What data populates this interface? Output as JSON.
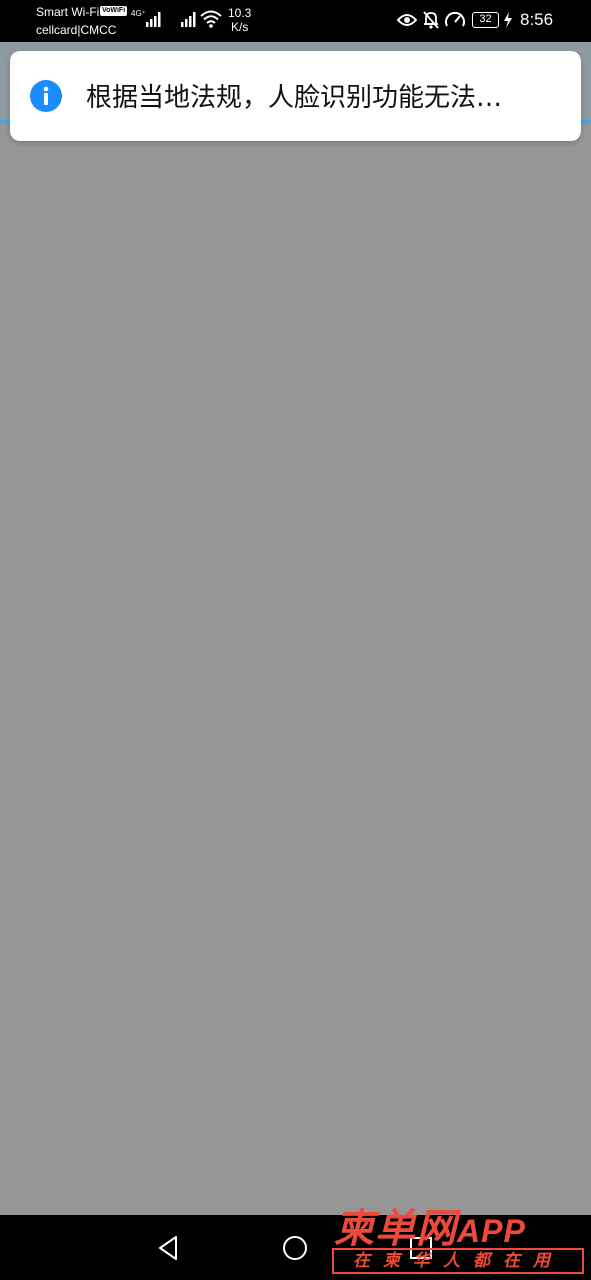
{
  "status_bar": {
    "carrier_line1": "Smart Wi-Fi",
    "volte_badge": "VoWiFi",
    "carrier_line2": "cellcard|CMCC",
    "network_type": "4G⁺",
    "speed_value": "10.3",
    "speed_unit": "K/s",
    "battery": "32",
    "time": "8:56",
    "icons": [
      "signal-icon",
      "wifi-icon",
      "eye-icon",
      "bell-off-icon",
      "gauge-icon",
      "battery-icon",
      "charging-icon"
    ]
  },
  "toast": {
    "icon": "info-icon",
    "message": "根据当地法规，人脸识别功能无法…",
    "accent_color": "#1a8cff"
  },
  "nav_bar": {
    "icons": [
      "back-icon",
      "home-icon",
      "recent-apps-icon"
    ]
  },
  "watermark": {
    "brand": "柬单网",
    "app": "APP",
    "slogan": "在柬华人都在用",
    "color": "#ee4a3a"
  }
}
